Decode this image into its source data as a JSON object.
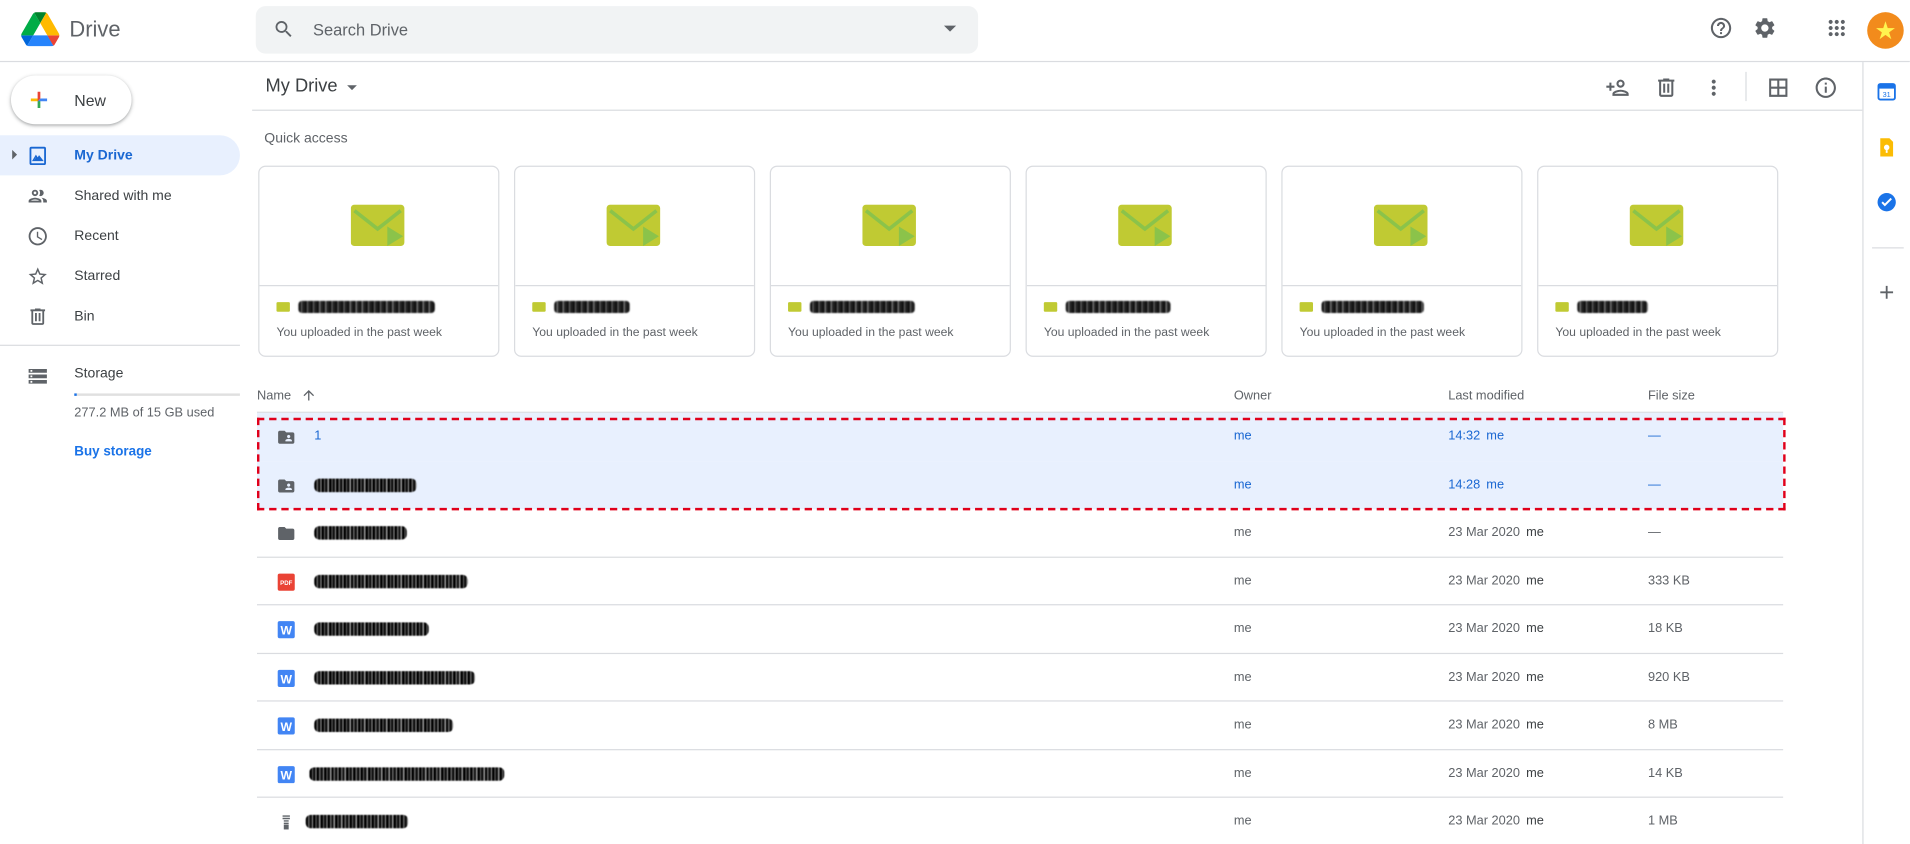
{
  "header": {
    "app_name": "Drive",
    "search_placeholder": "Search Drive"
  },
  "sidebar": {
    "new_label": "New",
    "items": [
      {
        "label": "My Drive",
        "icon": "my-drive-icon",
        "active": true
      },
      {
        "label": "Shared with me",
        "icon": "shared-icon"
      },
      {
        "label": "Recent",
        "icon": "clock-icon"
      },
      {
        "label": "Starred",
        "icon": "star-icon"
      },
      {
        "label": "Bin",
        "icon": "trash-icon"
      }
    ],
    "storage": {
      "label": "Storage",
      "used_text": "277.2 MB of 15 GB used",
      "used_fraction": 0.018,
      "buy_label": "Buy storage"
    }
  },
  "main": {
    "title": "My Drive",
    "quick_access_title": "Quick access",
    "quick_access": [
      {
        "subtitle": "You uploaded in the past week"
      },
      {
        "subtitle": "You uploaded in the past week"
      },
      {
        "subtitle": "You uploaded in the past week"
      },
      {
        "subtitle": "You uploaded in the past week"
      },
      {
        "subtitle": "You uploaded in the past week"
      },
      {
        "subtitle": "You uploaded in the past week"
      }
    ],
    "columns": {
      "name": "Name",
      "owner": "Owner",
      "modified": "Last modified",
      "size": "File size"
    },
    "files": [
      {
        "name": "1",
        "type": "shared-folder",
        "owner": "me",
        "modified": "14:32",
        "modified_by": "me",
        "size": "—",
        "selected": true
      },
      {
        "name": "",
        "type": "shared-folder",
        "owner": "me",
        "modified": "14:28",
        "modified_by": "me",
        "size": "—",
        "selected": true
      },
      {
        "name": "",
        "type": "folder",
        "owner": "me",
        "modified": "23 Mar 2020",
        "modified_by": "me",
        "size": "—"
      },
      {
        "name": "",
        "type": "pdf",
        "owner": "me",
        "modified": "23 Mar 2020",
        "modified_by": "me",
        "size": "333 KB"
      },
      {
        "name": "",
        "type": "word",
        "owner": "me",
        "modified": "23 Mar 2020",
        "modified_by": "me",
        "size": "18 KB"
      },
      {
        "name": "",
        "type": "word",
        "owner": "me",
        "modified": "23 Mar 2020",
        "modified_by": "me",
        "size": "920 KB"
      },
      {
        "name": "",
        "type": "word",
        "owner": "me",
        "modified": "23 Mar 2020",
        "modified_by": "me",
        "size": "8 MB"
      },
      {
        "name": "",
        "type": "word",
        "owner": "me",
        "modified": "23 Mar 2020",
        "modified_by": "me",
        "size": "14 KB"
      },
      {
        "name": "",
        "type": "archive",
        "owner": "me",
        "modified": "23 Mar 2020",
        "modified_by": "me",
        "size": "1 MB"
      }
    ]
  },
  "colors": {
    "accent": "#1a73e8",
    "selection": "#e8f0fe",
    "highlight_border": "#e0001b",
    "thumb_green": "#c0ca33"
  }
}
